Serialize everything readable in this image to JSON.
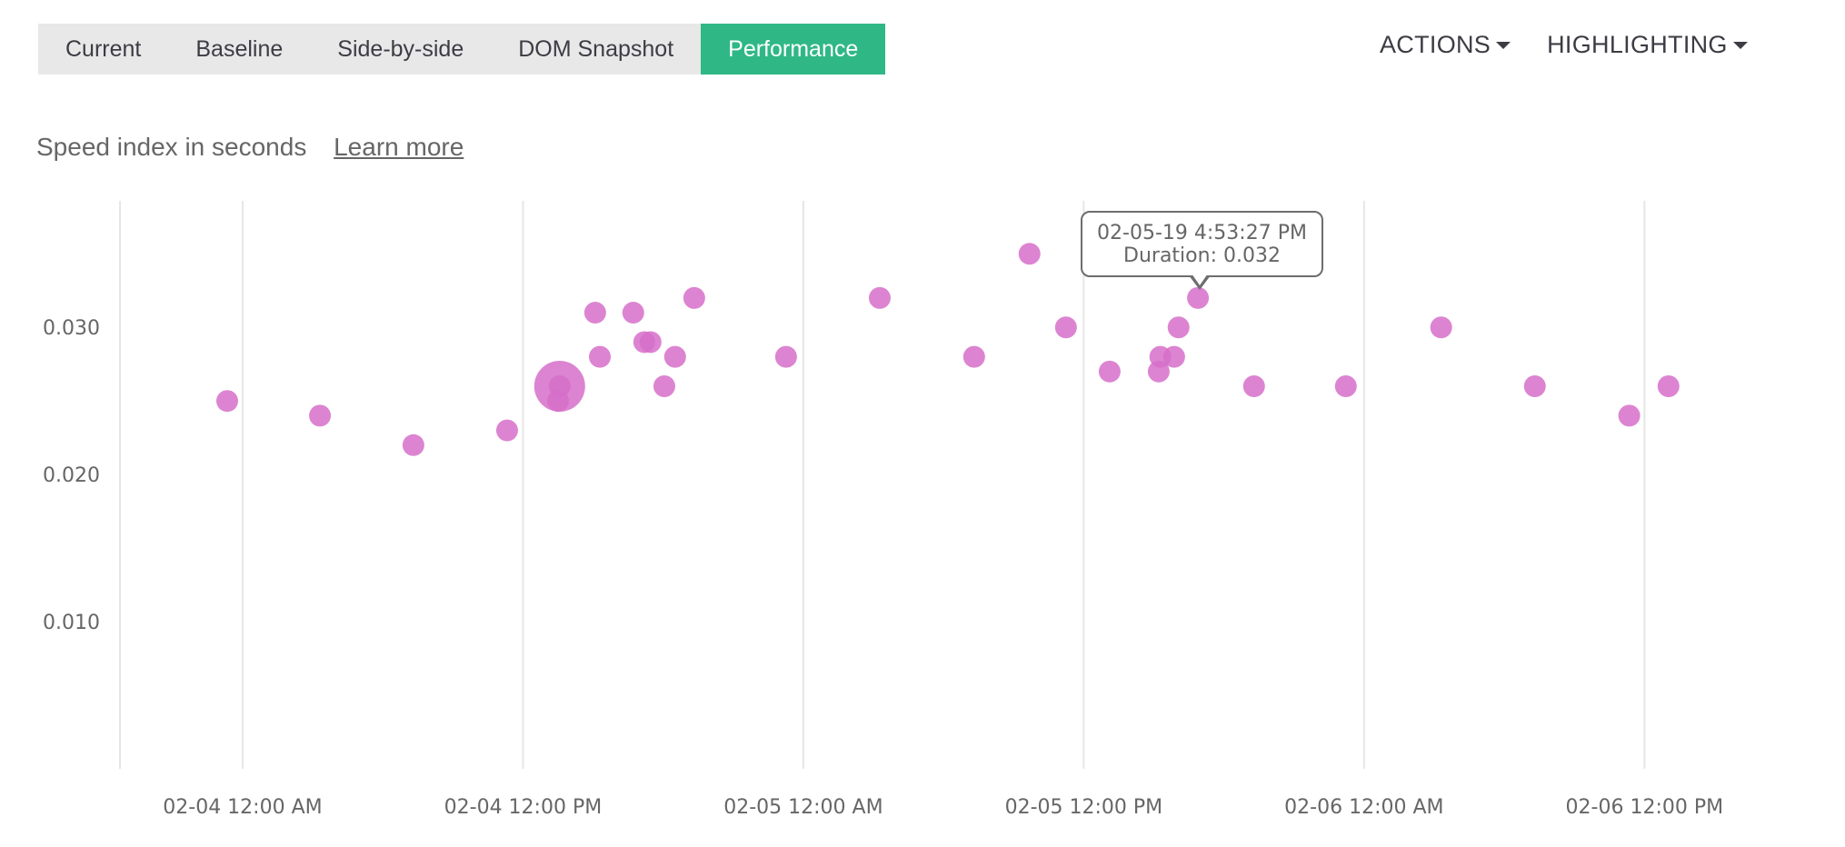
{
  "tabs": [
    {
      "label": "Current",
      "active": false
    },
    {
      "label": "Baseline",
      "active": false
    },
    {
      "label": "Side-by-side",
      "active": false
    },
    {
      "label": "DOM Snapshot",
      "active": false
    },
    {
      "label": "Performance",
      "active": true
    }
  ],
  "menus": {
    "actions_label": "ACTIONS",
    "highlighting_label": "HIGHLIGHTING"
  },
  "header": {
    "subtitle": "Speed index in seconds",
    "learn_more": "Learn more"
  },
  "colors": {
    "accent": "#2fb886",
    "point": "#d66fc9",
    "grid": "#e6e6e6"
  },
  "tooltip": {
    "line1": "02-05-19 4:53:27 PM",
    "line2": "Duration: 0.032"
  },
  "chart_data": {
    "type": "scatter",
    "title": "Speed index in seconds",
    "xlabel": "",
    "ylabel": "",
    "x_unit": "hours since 02-04 12:00 AM",
    "xlim": [
      -5.25,
      64.5
    ],
    "ylim": [
      0,
      0.0386
    ],
    "grid": "vertical",
    "y_ticks": [
      {
        "value": 0.01,
        "label": "0.010"
      },
      {
        "value": 0.02,
        "label": "0.020"
      },
      {
        "value": 0.03,
        "label": "0.030"
      }
    ],
    "x_ticks": [
      {
        "value": 0,
        "label": "02-04 12:00 AM"
      },
      {
        "value": 12,
        "label": "02-04 12:00 PM"
      },
      {
        "value": 24,
        "label": "02-05 12:00 AM"
      },
      {
        "value": 36,
        "label": "02-05 12:00 PM"
      },
      {
        "value": 48,
        "label": "02-06 12:00 AM"
      },
      {
        "value": 60,
        "label": "02-06 12:00 PM"
      }
    ],
    "series": [
      {
        "name": "Speed index",
        "points": [
          {
            "x": -0.66,
            "y": 0.025
          },
          {
            "x": 3.31,
            "y": 0.024
          },
          {
            "x": 7.31,
            "y": 0.022
          },
          {
            "x": 11.32,
            "y": 0.023
          },
          {
            "x": 13.57,
            "y": 0.026,
            "highlighted": true
          },
          {
            "x": 13.5,
            "y": 0.025
          },
          {
            "x": 15.09,
            "y": 0.031
          },
          {
            "x": 15.29,
            "y": 0.028
          },
          {
            "x": 16.72,
            "y": 0.031
          },
          {
            "x": 17.19,
            "y": 0.029
          },
          {
            "x": 17.46,
            "y": 0.029
          },
          {
            "x": 18.05,
            "y": 0.026
          },
          {
            "x": 18.51,
            "y": 0.028
          },
          {
            "x": 19.33,
            "y": 0.032
          },
          {
            "x": 23.26,
            "y": 0.028
          },
          {
            "x": 27.27,
            "y": 0.032
          },
          {
            "x": 31.31,
            "y": 0.028
          },
          {
            "x": 33.68,
            "y": 0.035
          },
          {
            "x": 35.24,
            "y": 0.03
          },
          {
            "x": 37.11,
            "y": 0.027
          },
          {
            "x": 39.21,
            "y": 0.027
          },
          {
            "x": 39.28,
            "y": 0.028
          },
          {
            "x": 39.87,
            "y": 0.028
          },
          {
            "x": 40.06,
            "y": 0.03
          },
          {
            "x": 40.89,
            "y": 0.032,
            "tooltip": true
          },
          {
            "x": 43.29,
            "y": 0.026
          },
          {
            "x": 47.22,
            "y": 0.026
          },
          {
            "x": 51.3,
            "y": 0.03
          },
          {
            "x": 55.31,
            "y": 0.026
          },
          {
            "x": 59.35,
            "y": 0.024
          },
          {
            "x": 61.03,
            "y": 0.026
          }
        ]
      }
    ]
  }
}
